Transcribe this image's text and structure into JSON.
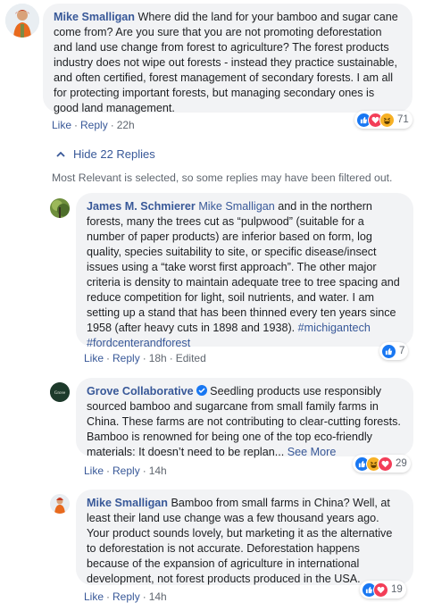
{
  "main_comment": {
    "author": "Mike Smalligan",
    "text": "Where did the land for your bamboo and sugar cane come from? Are you sure that you are not promoting deforestation and land use change from forest to agriculture? The forest products industry does not wipe out forests - instead they practice sustainable, and often certified, forest management of secondary forests. I am all for protecting important forests, but managing secondary ones is good land management.",
    "actions": {
      "like": "Like",
      "reply": "Reply",
      "time": "22h"
    },
    "reaction_icons": [
      "like-icon",
      "love-icon",
      "haha-icon"
    ],
    "reaction_count": "71"
  },
  "hide_replies": "Hide 22 Replies",
  "filter_note": "Most Relevant is selected, so some replies may have been filtered out.",
  "replies": [
    {
      "author": "James M. Schmierer",
      "mention": "Mike Smalligan",
      "text": " and in the northern forests, many the trees cut as “pulpwood” (suitable for a number of paper products) are inferior based on form, log quality, species suitability to site, or specific disease/insect issues using a “take worst first approach”. The other major criteria is density to maintain adequate tree to tree spacing and reduce competition for light, soil nutrients, and water. I am setting up a stand that has been thinned every ten years since 1958 (after heavy cuts in 1898 and 1938). ",
      "hashtag1": "#michigantech",
      "hashtag2": "#fordcenterandforest",
      "actions": {
        "like": "Like",
        "reply": "Reply",
        "time": "18h",
        "edited": "Edited"
      },
      "reaction_count": "7"
    },
    {
      "author": "Grove Collaborative",
      "text": " Seedling products use responsibly sourced bamboo and sugarcane from small family farms in China. These farms are not contributing to clear-cutting forests. Bamboo is renowned for being one of the top eco-friendly materials: It doesn’t need to be replan",
      "ellipsis": "...",
      "see_more": "See More",
      "avatar_text": "Grove",
      "actions": {
        "like": "Like",
        "reply": "Reply",
        "time": "14h"
      },
      "reaction_count": "29"
    },
    {
      "author": "Mike Smalligan",
      "text": " Bamboo from small farms in China? Well, at least their land use change was a few thousand years ago. Your product sounds lovely, but marketing it as the alternative to deforestation is not accurate. Deforestation happens because of the expansion of agriculture in international development, not forest products produced in the USA.",
      "actions": {
        "like": "Like",
        "reply": "Reply",
        "time": "14h"
      },
      "reaction_count": "19"
    }
  ],
  "colors": {
    "link": "#385898",
    "bubble": "#f2f3f5",
    "meta": "#606770",
    "like": "#1877f2",
    "love": "#f33e58",
    "haha": "#f7b125"
  }
}
